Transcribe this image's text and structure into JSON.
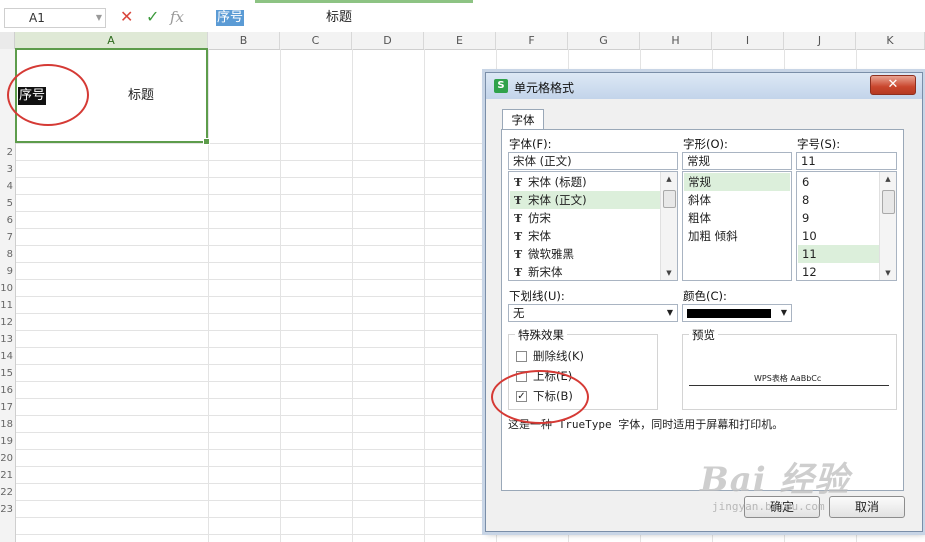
{
  "formula_bar": {
    "name_box": "A1",
    "cancel_icon": "✕",
    "confirm_icon": "✓",
    "fx_label": "fx",
    "formula_selected": "序号",
    "formula_rest": "标题"
  },
  "sheet": {
    "columns": [
      "A",
      "B",
      "C",
      "D",
      "E",
      "F",
      "G",
      "H",
      "I",
      "J",
      "K"
    ],
    "rows": [
      "",
      "2",
      "3",
      "4",
      "5",
      "6",
      "7",
      "8",
      "9",
      "10",
      "11",
      "12",
      "13",
      "14",
      "15",
      "16",
      "17",
      "18",
      "19",
      "20",
      "21",
      "22",
      "23"
    ],
    "cell_a1": "序号",
    "cell_a1_second": "标题"
  },
  "dialog": {
    "title": "单元格格式",
    "close_label": "✕",
    "app_icon_letter": "S",
    "tab_font": "字体",
    "font_label": "字体(F):",
    "font_value": "宋体 (正文)",
    "font_list": [
      "宋体 (标题)",
      "宋体 (正文)",
      "仿宋",
      "宋体",
      "微软雅黑",
      "新宋体"
    ],
    "font_selected_index": 1,
    "style_label": "字形(O):",
    "style_value": "常规",
    "style_list": [
      "常规",
      "斜体",
      "粗体",
      "加粗 倾斜"
    ],
    "size_label": "字号(S):",
    "size_value": "11",
    "size_list": [
      "6",
      "8",
      "9",
      "10",
      "11",
      "12"
    ],
    "size_selected_index": 4,
    "underline_label": "下划线(U):",
    "underline_value": "无",
    "color_label": "颜色(C):",
    "color_value": "#000000",
    "effects_label": "特殊效果",
    "strike_label": "删除线(K)",
    "strike_checked": false,
    "super_label": "上标(E)",
    "super_checked": false,
    "sub_label": "下标(B)",
    "sub_checked": true,
    "preview_label": "预览",
    "preview_text": "WPS表格  AaBbCc",
    "hint_text": "这是一种 TrueType 字体，同时适用于屏幕和打印机。",
    "ok_label": "确定",
    "cancel_label": "取消"
  },
  "watermark": {
    "main": "Bai 经验",
    "sub": "jingyan.baidu.com"
  }
}
